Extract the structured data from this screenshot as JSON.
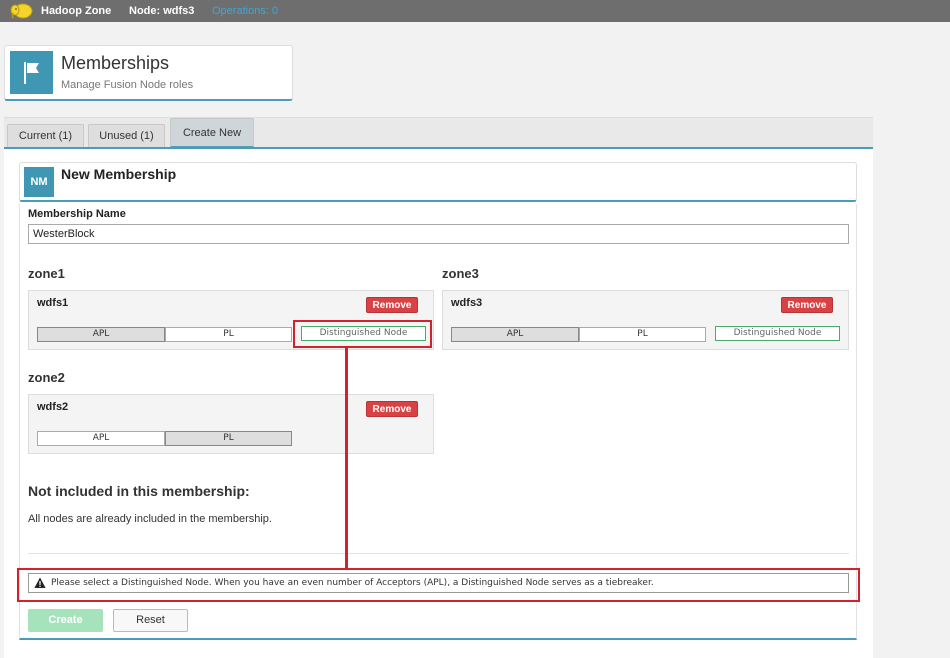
{
  "topbar": {
    "zone_name": "Hadoop Zone",
    "node_label": "Node: wdfs3",
    "operations": "Operations: 0",
    "logo_icon": "hadoop-elephant-icon"
  },
  "header": {
    "title": "Memberships",
    "subtitle": "Manage Fusion Node roles",
    "icon": "flag-icon"
  },
  "tabs": [
    {
      "label": "Current (1)"
    },
    {
      "label": "Unused (1)"
    },
    {
      "label": "Create New",
      "active": true
    }
  ],
  "new_membership": {
    "badge": "NM",
    "title": "New Membership",
    "name_label": "Membership Name",
    "name_value": "WesterBlock"
  },
  "zones": [
    {
      "title": "zone1",
      "node": "wdfs1",
      "remove": "Remove",
      "roles": [
        {
          "label": "APL",
          "selected": true
        },
        {
          "label": "PL",
          "selected": false
        },
        {
          "label": "Distinguished Node",
          "selected": false
        }
      ]
    },
    {
      "title": "zone3",
      "node": "wdfs3",
      "remove": "Remove",
      "roles": [
        {
          "label": "APL",
          "selected": true
        },
        {
          "label": "PL",
          "selected": false
        },
        {
          "label": "Distinguished Node",
          "selected": false
        }
      ]
    },
    {
      "title": "zone2",
      "node": "wdfs2",
      "remove": "Remove",
      "roles": [
        {
          "label": "APL",
          "selected": false
        },
        {
          "label": "PL",
          "selected": true
        }
      ]
    }
  ],
  "not_included": {
    "title": "Not included in this membership:",
    "text": "All nodes are already included in the membership."
  },
  "warning": {
    "text": "Please select a Distinguished Node. When you have an even number of Acceptors (APL), a Distinguished Node serves as a tiebreaker.",
    "icon": "warning-icon"
  },
  "buttons": {
    "create": "Create",
    "reset": "Reset"
  },
  "colors": {
    "accent": "#4097b3",
    "danger": "#d94244",
    "annotation": "#d2222d",
    "create_disabled": "#a6e3bd"
  }
}
